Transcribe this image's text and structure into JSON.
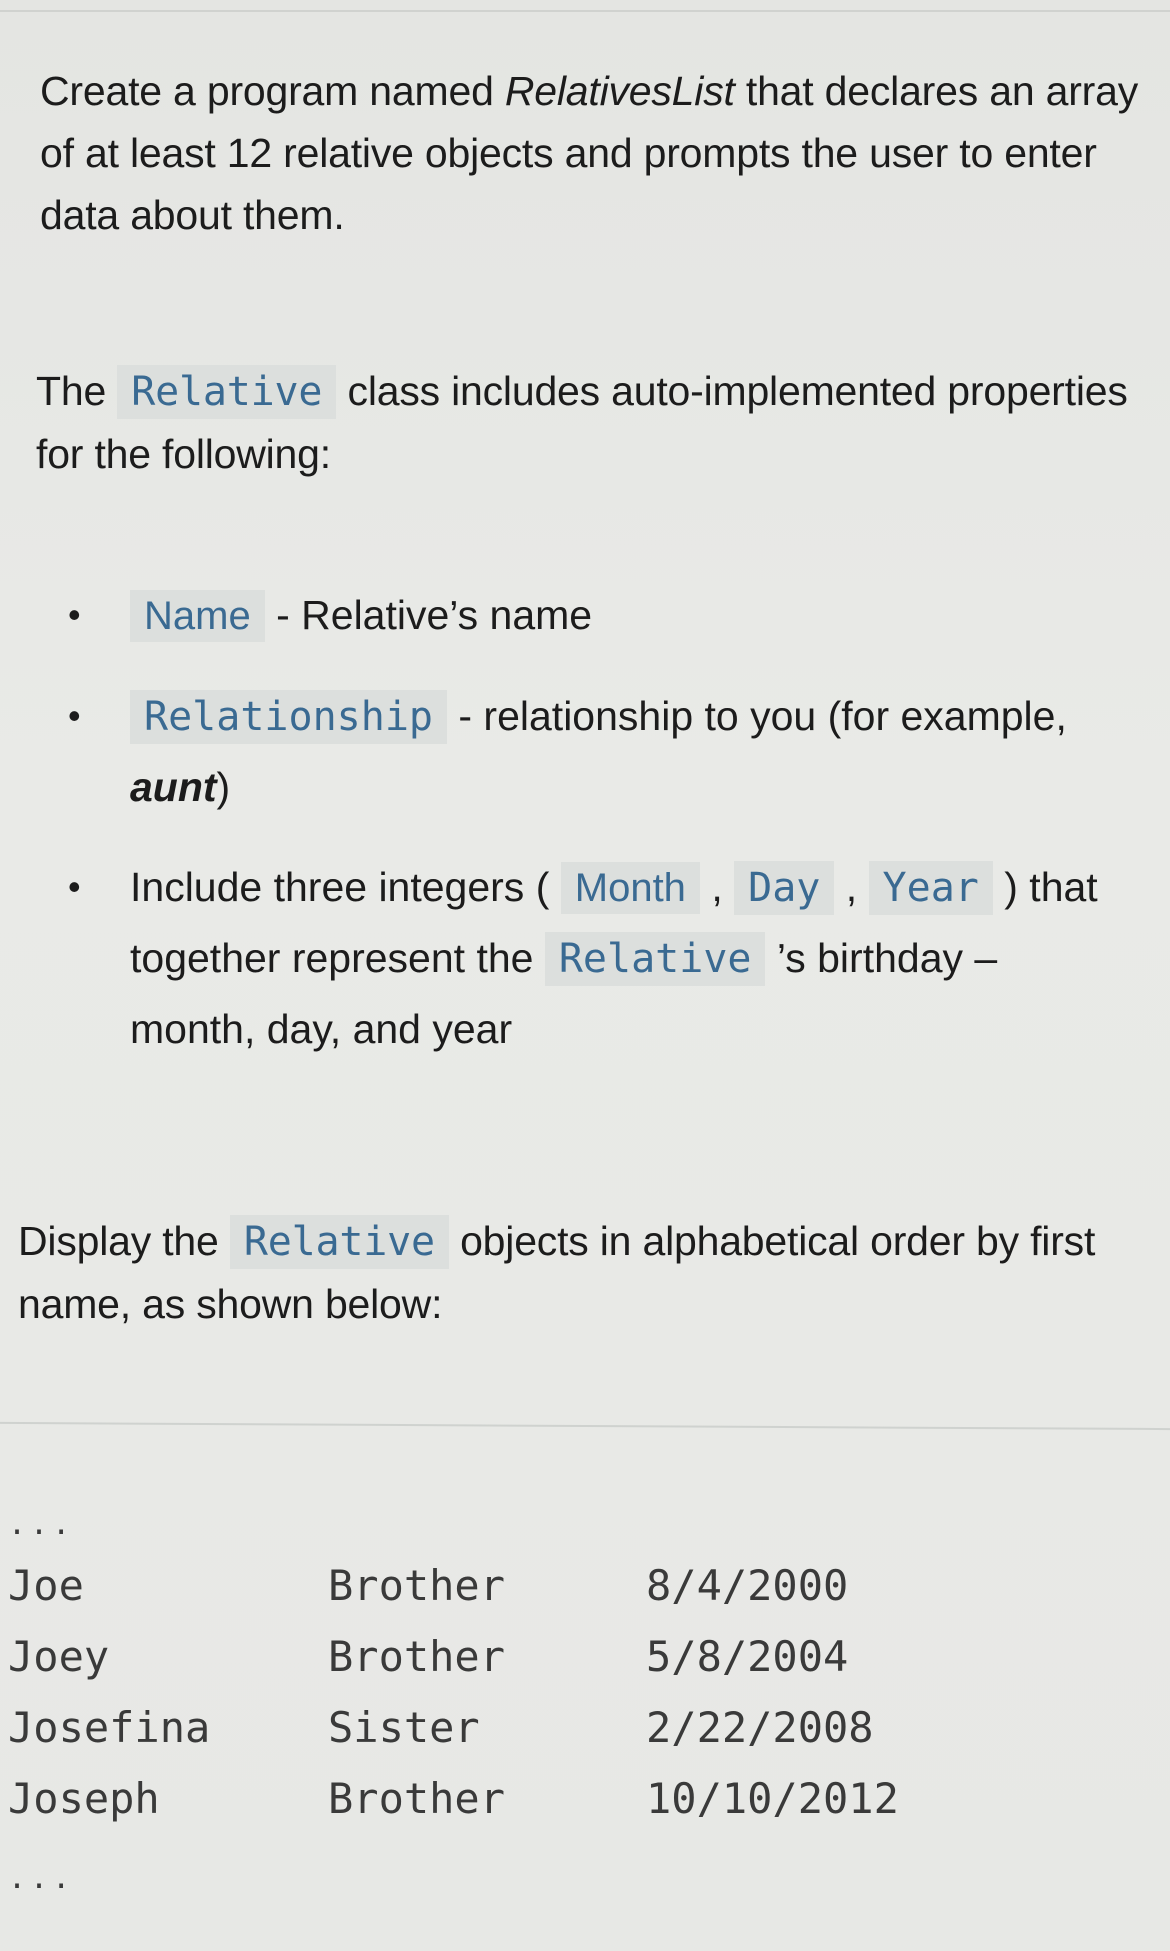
{
  "intro": {
    "text_before": "Create a program named ",
    "program_name": "RelativesList",
    "text_after": " that declares an array of at least 12 relative objects and prompts the user to enter data about them."
  },
  "class_desc": {
    "text_before": "The ",
    "class_name": "Relative",
    "text_after": " class includes auto-implemented properties for the following:"
  },
  "properties": [
    {
      "code": "Name",
      "desc": " - Relative’s name"
    },
    {
      "code": "Relationship",
      "desc_before": " - relationship to you (for example, ",
      "desc_bold": "aunt",
      "desc_after": ")"
    },
    {
      "text_before": "Include three integers ( ",
      "code_month": "Month",
      "sep1": " , ",
      "code_day": "Day",
      "sep2": " , ",
      "code_year": "Year",
      "text_mid": " ) that together represent the ",
      "code_relative": "Relative",
      "text_after": " ’s birthday – month, day, and year"
    }
  ],
  "display": {
    "text_before": "Display the ",
    "class_name": "Relative",
    "text_after": " objects in alphabetical order by first name, as shown below:"
  },
  "sample_output": {
    "ellipsis_top": "...",
    "rows": [
      {
        "name": "Joe",
        "relationship": "Brother",
        "birthday": "8/4/2000"
      },
      {
        "name": "Joey",
        "relationship": "Brother",
        "birthday": "5/8/2004"
      },
      {
        "name": "Josefina",
        "relationship": "Sister",
        "birthday": "2/22/2008"
      },
      {
        "name": "Joseph",
        "relationship": "Brother",
        "birthday": "10/10/2012"
      }
    ],
    "ellipsis_bottom": "..."
  },
  "colors": {
    "code_text": "#3a6a92",
    "code_background": "#dcdfdd",
    "body_text": "#1c1c1c",
    "page_background": "#e7e8e5"
  },
  "icons": {
    "bullet": "•"
  }
}
